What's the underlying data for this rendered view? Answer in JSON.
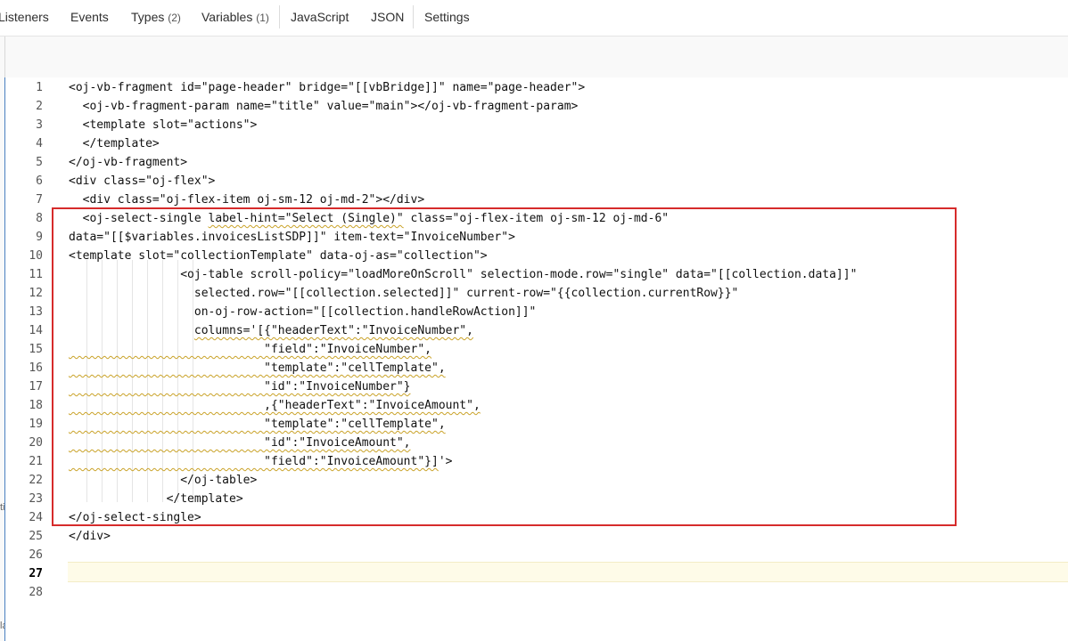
{
  "tabs": [
    {
      "label": "Listeners",
      "count": ""
    },
    {
      "label": "Events",
      "count": ""
    },
    {
      "label": "Types",
      "count": "(2)"
    },
    {
      "label": "Variables",
      "count": "(1)"
    },
    {
      "label": "JavaScript",
      "count": ""
    },
    {
      "label": "JSON",
      "count": ""
    },
    {
      "label": "Settings",
      "count": ""
    }
  ],
  "left_rail_fragments": [
    "ti",
    "la"
  ],
  "editor": {
    "current_line": "27",
    "lines": [
      {
        "n": "1"
      },
      {
        "n": "2"
      },
      {
        "n": "3"
      },
      {
        "n": "4"
      },
      {
        "n": "5"
      },
      {
        "n": "6"
      },
      {
        "n": "7"
      },
      {
        "n": "8"
      },
      {
        "n": "9"
      },
      {
        "n": "10"
      },
      {
        "n": "11"
      },
      {
        "n": "12"
      },
      {
        "n": "13"
      },
      {
        "n": "14"
      },
      {
        "n": "15"
      },
      {
        "n": "16"
      },
      {
        "n": "17"
      },
      {
        "n": "18"
      },
      {
        "n": "19"
      },
      {
        "n": "20"
      },
      {
        "n": "21"
      },
      {
        "n": "22"
      },
      {
        "n": "23"
      },
      {
        "n": "24"
      },
      {
        "n": "25"
      },
      {
        "n": "26"
      },
      {
        "n": "27"
      },
      {
        "n": "28"
      }
    ],
    "code": {
      "l1": "<oj-vb-fragment id=\"page-header\" bridge=\"[[vbBridge]]\" name=\"page-header\">",
      "l2": "  <oj-vb-fragment-param name=\"title\" value=\"main\"></oj-vb-fragment-param>",
      "l3": "  <template slot=\"actions\">",
      "l4": "  </template>",
      "l5": "</oj-vb-fragment>",
      "l6": "<div class=\"oj-flex\">",
      "l7": "  <div class=\"oj-flex-item oj-sm-12 oj-md-2\"></div>",
      "l8a": "  <oj-select-single ",
      "l8b": "label-hint=\"Select (Single)\"",
      "l8c": " class=\"oj-flex-item oj-sm-12 oj-md-6\"",
      "l9": "data=\"[[$variables.invoicesListSDP]]\" item-text=\"InvoiceNumber\">",
      "l10": "<template slot=\"collectionTemplate\" data-oj-as=\"collection\">",
      "l11": "                <oj-table scroll-policy=\"loadMoreOnScroll\" selection-mode.row=\"single\" data=\"[[collection.data]]\"",
      "l12": "                  selected.row=\"[[collection.selected]]\" current-row=\"{{collection.currentRow}}\"",
      "l13": "                  on-oj-row-action=\"[[collection.handleRowAction]]\"",
      "l14a": "                  ",
      "l14b": "columns='[{\"headerText\":\"InvoiceNumber\",",
      "l15": "                            \"field\":\"InvoiceNumber\",",
      "l16": "                            \"template\":\"cellTemplate\",",
      "l17": "                            \"id\":\"InvoiceNumber\"}",
      "l18": "                            ,{\"headerText\":\"InvoiceAmount\",",
      "l19": "                            \"template\":\"cellTemplate\",",
      "l20": "                            \"id\":\"InvoiceAmount\",",
      "l21a": "                            \"field\":\"InvoiceAmount\"}]",
      "l21b": "'>",
      "l22": "                </oj-table>",
      "l23": "              </template>",
      "l24": "</oj-select-single>",
      "l25": "</div>",
      "l26": "",
      "l27": "",
      "l28": ""
    }
  },
  "colors": {
    "highlight_box": "#d62b2b",
    "tag": "#1c4aa2",
    "string": "#8c5d10",
    "current_line_bg": "#fefbe8",
    "squiggle": "#c9a227"
  }
}
